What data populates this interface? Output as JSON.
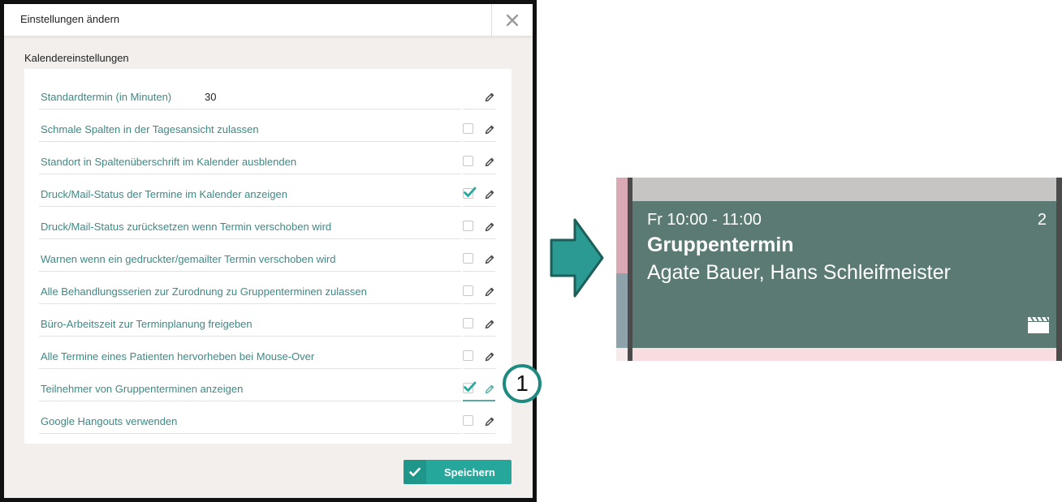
{
  "dialog": {
    "title": "Einstellungen ändern",
    "section_title": "Kalendereinstellungen",
    "save_label": "Speichern",
    "accent_color": "#25a89b",
    "label_color": "#3b8a86",
    "settings": [
      {
        "label": "Standardtermin (in Minuten)",
        "value": "30",
        "type": "value"
      },
      {
        "label": "Schmale Spalten in der Tagesansicht zulassen",
        "type": "checkbox",
        "checked": false
      },
      {
        "label": "Standort in Spaltenüberschrift im Kalender ausblenden",
        "type": "checkbox",
        "checked": false
      },
      {
        "label": "Druck/Mail-Status der Termine im Kalender anzeigen",
        "type": "checkbox",
        "checked": true
      },
      {
        "label": "Druck/Mail-Status zurücksetzen wenn Termin verschoben wird",
        "type": "checkbox",
        "checked": false
      },
      {
        "label": "Warnen wenn ein gedruckter/gemailter Termin verschoben wird",
        "type": "checkbox",
        "checked": false
      },
      {
        "label": "Alle Behandlungsserien zur Zurodnung zu Gruppenterminen zulassen",
        "type": "checkbox",
        "checked": false
      },
      {
        "label": "Büro-Arbeitszeit zur Terminplanung freigeben",
        "type": "checkbox",
        "checked": false
      },
      {
        "label": "Alle Termine eines Patienten hervorheben bei Mouse-Over",
        "type": "checkbox",
        "checked": false
      },
      {
        "label": "Teilnehmer von Gruppenterminen anzeigen",
        "type": "checkbox",
        "checked": true,
        "highlighted": true
      },
      {
        "label": "Google Hangouts verwenden",
        "type": "checkbox",
        "checked": false
      }
    ]
  },
  "callout": {
    "number": "1"
  },
  "calendar_event": {
    "time": "Fr 10:00 - 11:00",
    "count": "2",
    "title": "Gruppentermin",
    "participants": "Agate Bauer, Hans Schleifmeister",
    "event_color": "#5a7a73",
    "icon": "clapperboard-icon"
  }
}
